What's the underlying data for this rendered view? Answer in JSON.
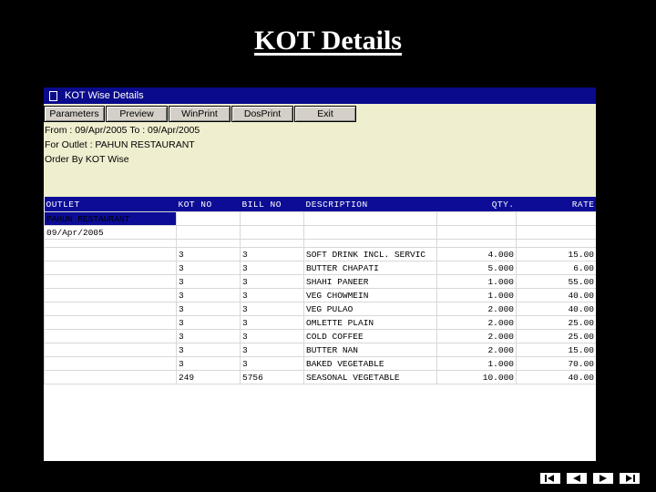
{
  "slide": {
    "title": "KOT Details"
  },
  "window": {
    "title": "KOT Wise Details"
  },
  "toolbar": {
    "parameters": "Parameters",
    "preview": "Preview",
    "winprint": "WinPrint",
    "dosprint": "DosPrint",
    "exit": "Exit"
  },
  "info": {
    "range": "From : 09/Apr/2005 To : 09/Apr/2005",
    "outlet": "For Outlet : PAHUN RESTAURANT",
    "order": "Order By KOT Wise"
  },
  "columns": [
    "OUTLET",
    "KOT NO",
    "BILL NO",
    "DESCRIPTION",
    "QTY.",
    "RATE"
  ],
  "group": {
    "outlet": "PAHUN RESTAURANT",
    "date": "09/Apr/2005"
  },
  "rows": [
    {
      "kot": "3",
      "bill": "3",
      "desc": "SOFT DRINK INCL. SERVIC",
      "qty": "4.000",
      "rate": "15.00"
    },
    {
      "kot": "3",
      "bill": "3",
      "desc": "BUTTER CHAPATI",
      "qty": "5.000",
      "rate": "6.00"
    },
    {
      "kot": "3",
      "bill": "3",
      "desc": "SHAHI PANEER",
      "qty": "1.000",
      "rate": "55.00"
    },
    {
      "kot": "3",
      "bill": "3",
      "desc": "VEG CHOWMEIN",
      "qty": "1.000",
      "rate": "40.00"
    },
    {
      "kot": "3",
      "bill": "3",
      "desc": "VEG PULAO",
      "qty": "2.000",
      "rate": "40.00"
    },
    {
      "kot": "3",
      "bill": "3",
      "desc": "OMLETTE PLAIN",
      "qty": "2.000",
      "rate": "25.00"
    },
    {
      "kot": "3",
      "bill": "3",
      "desc": "COLD COFFEE",
      "qty": "2.000",
      "rate": "25.00"
    },
    {
      "kot": "3",
      "bill": "3",
      "desc": "BUTTER NAN",
      "qty": "2.000",
      "rate": "15.00"
    },
    {
      "kot": "3",
      "bill": "3",
      "desc": "BAKED VEGETABLE",
      "qty": "1.000",
      "rate": "70.00"
    },
    {
      "kot": "249",
      "bill": "5756",
      "desc": "SEASONAL VEGETABLE",
      "qty": "10.000",
      "rate": "40.00"
    }
  ],
  "nav_icons": [
    "first-icon",
    "prev-icon",
    "next-icon",
    "last-icon"
  ]
}
